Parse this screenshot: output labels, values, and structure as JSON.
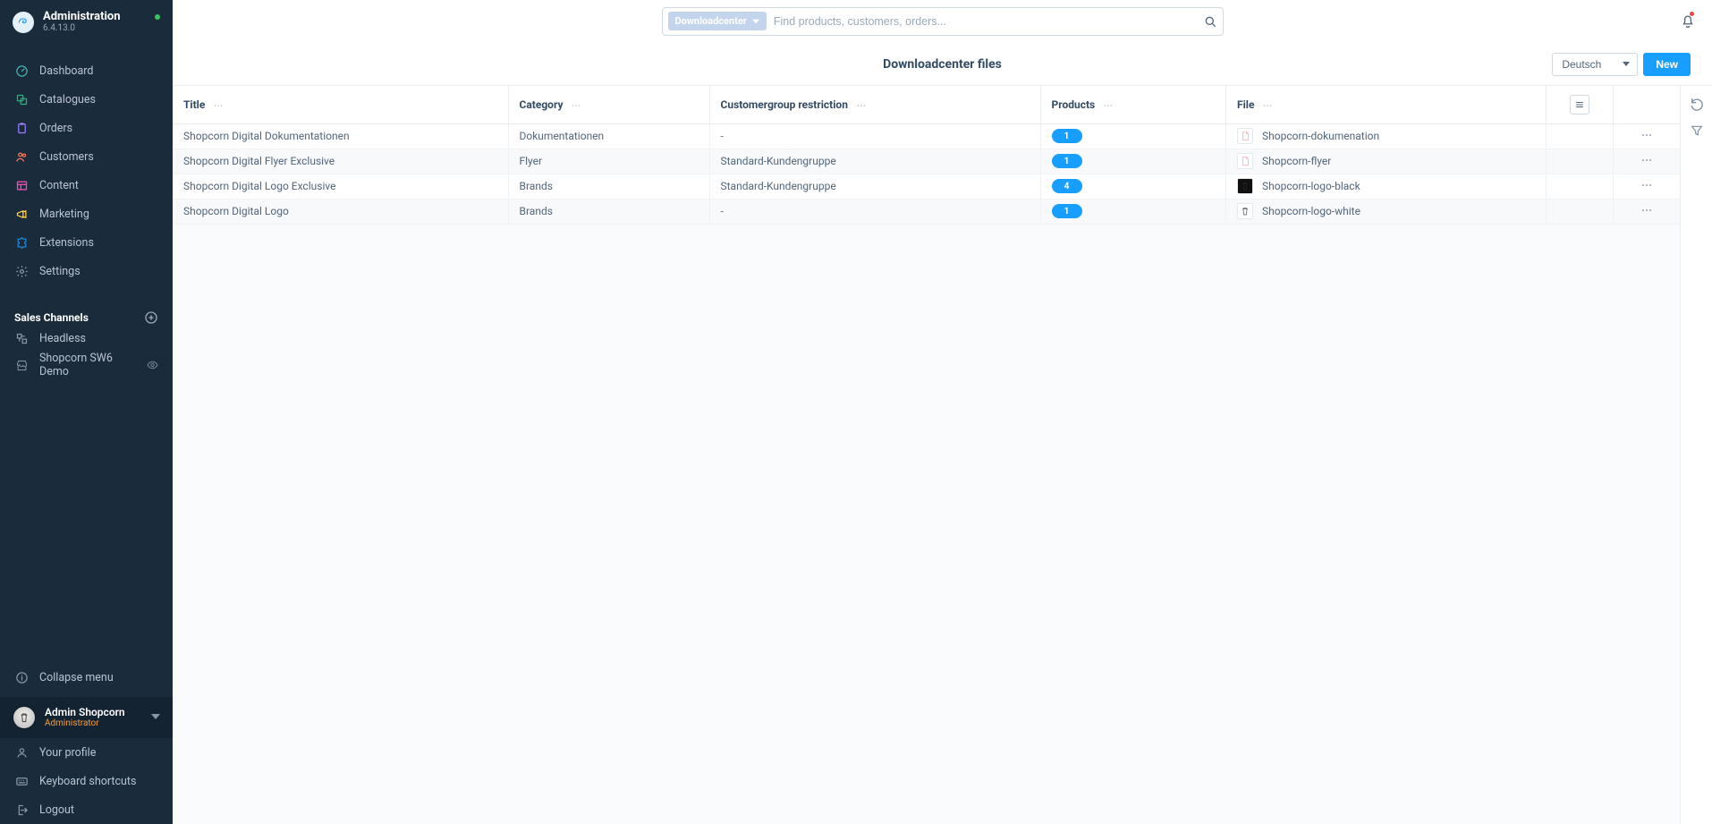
{
  "app": {
    "title": "Administration",
    "version": "6.4.13.0"
  },
  "sidebar": {
    "nav": [
      {
        "label": "Dashboard",
        "icon": "gauge",
        "color": "#3fb5b0"
      },
      {
        "label": "Catalogues",
        "icon": "stack",
        "color": "#2bb37a"
      },
      {
        "label": "Orders",
        "icon": "clipboard",
        "color": "#9a7cff"
      },
      {
        "label": "Customers",
        "icon": "users",
        "color": "#ff7a59"
      },
      {
        "label": "Content",
        "icon": "layout",
        "color": "#ff4db8"
      },
      {
        "label": "Marketing",
        "icon": "megaphone",
        "color": "#ffd43b"
      },
      {
        "label": "Extensions",
        "icon": "puzzle",
        "color": "#189eff"
      },
      {
        "label": "Settings",
        "icon": "gear",
        "color": "#8895a7"
      }
    ],
    "section_title": "Sales Channels",
    "channels": [
      {
        "label": "Headless",
        "icon": "api",
        "eye": false
      },
      {
        "label": "Shopcorn SW6 Demo",
        "icon": "store",
        "eye": true
      }
    ],
    "collapse_label": "Collapse menu",
    "user": {
      "name": "Admin Shopcorn",
      "role": "Administrator"
    },
    "user_menu": [
      {
        "label": "Your profile",
        "icon": "user"
      },
      {
        "label": "Keyboard shortcuts",
        "icon": "keyboard"
      },
      {
        "label": "Logout",
        "icon": "logout"
      }
    ]
  },
  "search": {
    "type_label": "Downloadcenter",
    "placeholder": "Find products, customers, orders..."
  },
  "page": {
    "title": "Downloadcenter files",
    "language": "Deutsch",
    "new_button": "New"
  },
  "table": {
    "columns": {
      "title": "Title",
      "category": "Category",
      "restriction": "Customergroup restriction",
      "products": "Products",
      "file": "File"
    },
    "rows": [
      {
        "title": "Shopcorn Digital Dokumentationen",
        "category": "Dokumentationen",
        "restriction": "-",
        "products": 1,
        "file": "Shopcorn-dokumenation",
        "thumb": "doc"
      },
      {
        "title": "Shopcorn Digital Flyer Exclusive",
        "category": "Flyer",
        "restriction": "Standard-Kundengruppe",
        "products": 1,
        "file": "Shopcorn-flyer",
        "thumb": "doc"
      },
      {
        "title": "Shopcorn Digital Logo Exclusive",
        "category": "Brands",
        "restriction": "Standard-Kundengruppe",
        "products": 4,
        "file": "Shopcorn-logo-black",
        "thumb": "img-dark"
      },
      {
        "title": "Shopcorn Digital Logo",
        "category": "Brands",
        "restriction": "-",
        "products": 1,
        "file": "Shopcorn-logo-white",
        "thumb": "img-light"
      }
    ]
  }
}
